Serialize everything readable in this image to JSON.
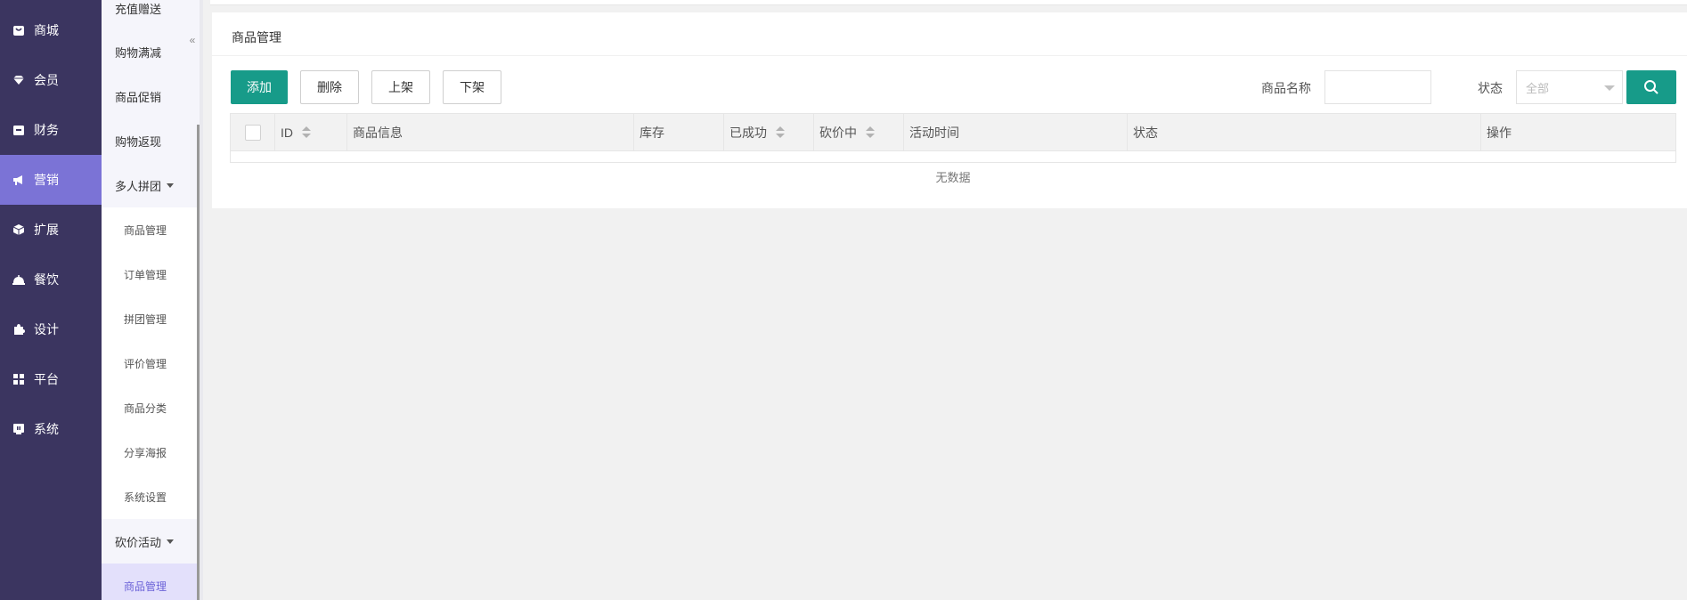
{
  "leftnav": {
    "items": [
      {
        "label": "商城",
        "icon": "shop-bag-icon"
      },
      {
        "label": "会员",
        "icon": "gem-icon"
      },
      {
        "label": "财务",
        "icon": "wallet-icon"
      },
      {
        "label": "营销",
        "icon": "megaphone-icon",
        "active": true
      },
      {
        "label": "扩展",
        "icon": "cube-icon"
      },
      {
        "label": "餐饮",
        "icon": "dish-cover-icon"
      },
      {
        "label": "设计",
        "icon": "puzzle-icon"
      },
      {
        "label": "平台",
        "icon": "grid-icon"
      },
      {
        "label": "系统",
        "icon": "monitor-icon"
      }
    ]
  },
  "subnav": {
    "items": [
      {
        "label": "充值赠送"
      },
      {
        "label": "购物满减"
      },
      {
        "label": "商品促销"
      },
      {
        "label": "购物返现"
      },
      {
        "label": "多人拼团",
        "expandable": true
      },
      {
        "label": "商品管理",
        "child": true
      },
      {
        "label": "订单管理",
        "child": true
      },
      {
        "label": "拼团管理",
        "child": true
      },
      {
        "label": "评价管理",
        "child": true
      },
      {
        "label": "商品分类",
        "child": true
      },
      {
        "label": "分享海报",
        "child": true
      },
      {
        "label": "系统设置",
        "child": true
      },
      {
        "label": "砍价活动",
        "expandable": true
      },
      {
        "label": "商品管理",
        "child": true,
        "active": true
      }
    ],
    "collapse_symbol": "«"
  },
  "main": {
    "title": "商品管理",
    "buttons": {
      "add": "添加",
      "delete": "删除",
      "on_shelf": "上架",
      "off_shelf": "下架"
    },
    "filters": {
      "name_label": "商品名称",
      "name_value": "",
      "status_label": "状态",
      "status_value": "全部"
    },
    "table": {
      "columns": [
        "ID",
        "商品信息",
        "库存",
        "已成功",
        "砍价中",
        "活动时间",
        "状态",
        "操作"
      ],
      "empty_text": "无数据"
    },
    "accent_color": "#179b89",
    "nav_active_color": "#7b73d6"
  }
}
